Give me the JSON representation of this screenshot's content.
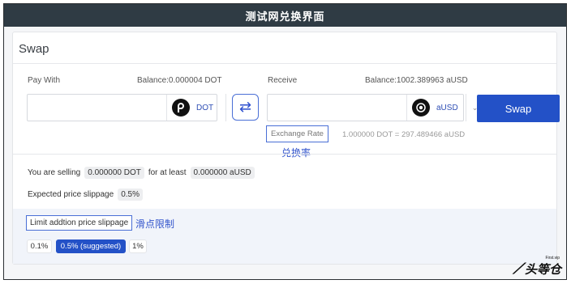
{
  "window": {
    "title": "测试网兑换界面"
  },
  "swap": {
    "title": "Swap",
    "pay": {
      "label": "Pay With",
      "balance": "Balance:0.000004 DOT",
      "amount": "",
      "token": "DOT",
      "token_icon": "polkadot-logo-icon"
    },
    "receive": {
      "label": "Receive",
      "balance": "Balance:1002.389963 aUSD",
      "amount": "",
      "token": "aUSD",
      "token_icon": "acala-logo-icon"
    },
    "switch_icon": "swap-arrows-icon",
    "button_label": "Swap",
    "exchange_rate_label": "Exchange Rate",
    "exchange_rate_value": "1.000000 DOT = 297.489466 aUSD",
    "selling": {
      "prefix": "You are selling",
      "amount": "0.000000 DOT",
      "middle": "for at least",
      "receive": "0.000000 aUSD"
    },
    "expected_slippage": {
      "label": "Expected price slippage",
      "value": "0.5%"
    },
    "limit_slippage": {
      "label": "Limit addtion price slippage",
      "options": [
        "0.1%",
        "0.5% (suggested)",
        "1%"
      ],
      "selected": "0.5% (suggested)"
    }
  },
  "annotations": {
    "exchange_rate": "兑换率",
    "slippage_limit": "滑点限制"
  },
  "watermark": {
    "text": "头等仓",
    "small": "First.vip"
  },
  "colors": {
    "accent": "#2351c7",
    "titlebar": "#2f3b44",
    "annotation": "#3355cc"
  }
}
